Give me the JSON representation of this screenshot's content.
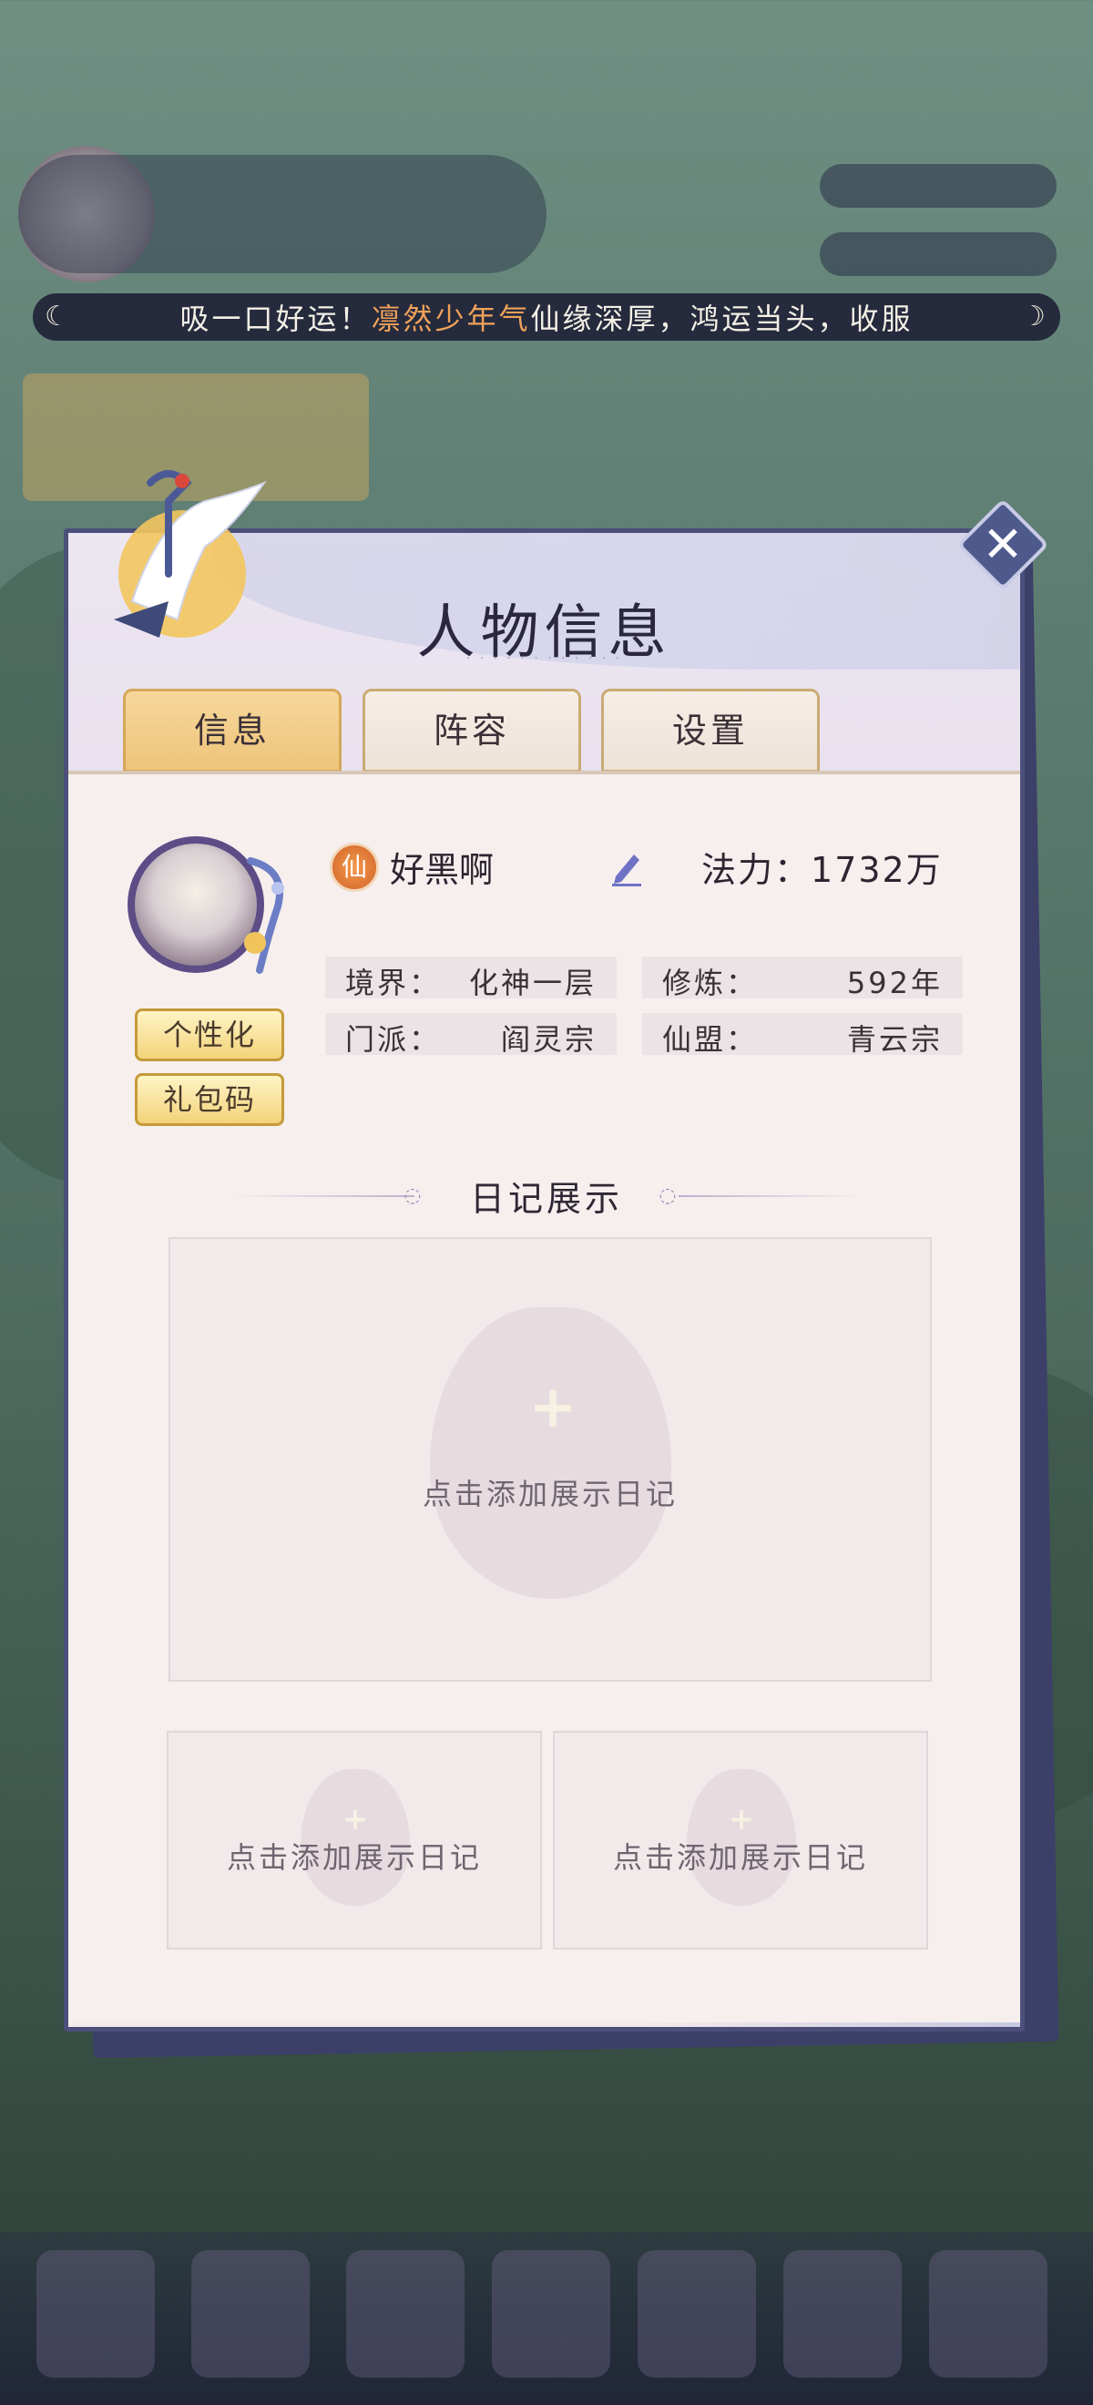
{
  "marquee": {
    "prefix": "吸一口好运！",
    "highlight": "凛然少年气",
    "suffix": "仙缘深厚，鸿运当头，收服"
  },
  "panel": {
    "title": "人物信息"
  },
  "tabs": [
    {
      "label": "信息",
      "active": true
    },
    {
      "label": "阵容",
      "active": false
    },
    {
      "label": "设置",
      "active": false
    }
  ],
  "profile": {
    "badge": "仙",
    "name": "好黑啊",
    "power_label": "法力：",
    "power_value": "1732万",
    "buttons": {
      "personalize": "个性化",
      "gift_code": "礼包码"
    },
    "stats": {
      "realm_label": "境界：",
      "realm_value": "化神一层",
      "cultivation_label": "修炼：",
      "cultivation_value": "592年",
      "sect_label": "门派：",
      "sect_value": "阎灵宗",
      "alliance_label": "仙盟：",
      "alliance_value": "青云宗"
    }
  },
  "diary": {
    "section_title": "日记展示",
    "slots": [
      {
        "label": "点击添加展示日记"
      },
      {
        "label": "点击添加展示日记"
      },
      {
        "label": "点击添加展示日记"
      }
    ]
  },
  "icons": [
    "close-icon",
    "edit-icon",
    "plus-icon",
    "crane-icon",
    "moon-icon"
  ],
  "colors": {
    "accent_gold": "#f3d37a",
    "highlight_orange": "#f0a25a",
    "panel_border": "#4b4f7a"
  }
}
